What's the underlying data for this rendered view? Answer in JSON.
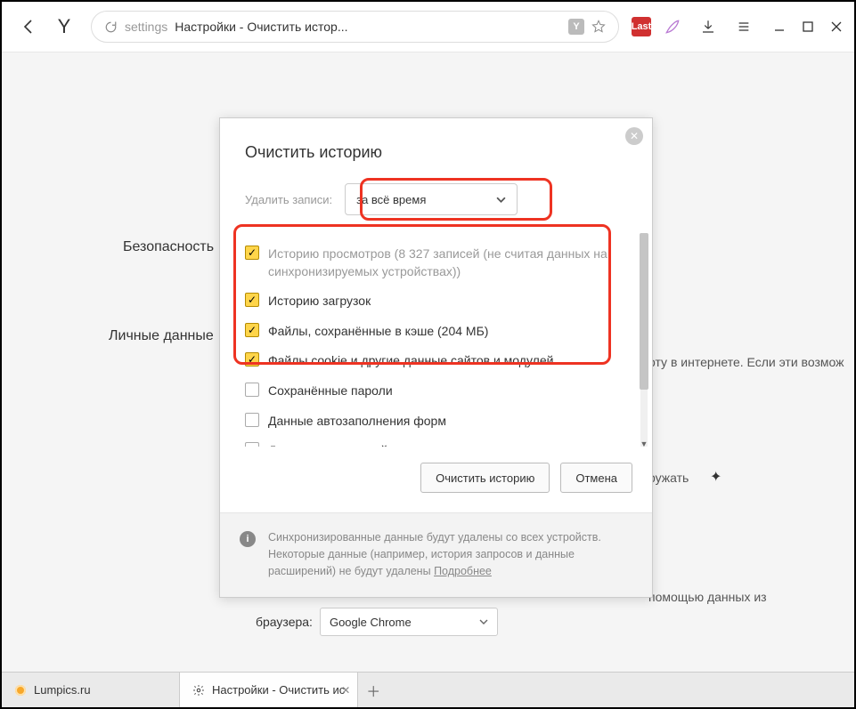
{
  "toolbar": {
    "address_label": "settings",
    "address_title": "Настройки - Очистить истор...",
    "ext_last": "Last",
    "y_badge": "Y"
  },
  "sidebar": {
    "security": "Безопасность",
    "personal": "Личные данные"
  },
  "bg": {
    "right1": "оту в интернете. Если эти возмож",
    "right2": "ружать",
    "right3": "помощью данных из",
    "browser_label": "браузера:",
    "browser_value": "Google Chrome"
  },
  "dialog": {
    "title": "Очистить историю",
    "delete_label": "Удалить записи:",
    "time_value": "за всё время",
    "items": [
      {
        "checked": true,
        "muted": true,
        "label": "Историю просмотров (8 327 записей (не считая данных на синхронизируемых устройствах))"
      },
      {
        "checked": true,
        "muted": false,
        "label": "Историю загрузок"
      },
      {
        "checked": true,
        "muted": false,
        "label": "Файлы, сохранённые в кэше (204 МБ)"
      },
      {
        "checked": true,
        "muted": false,
        "label": "Файлы cookie и другие данные сайтов и модулей"
      },
      {
        "checked": false,
        "muted": false,
        "label": "Сохранённые пароли"
      },
      {
        "checked": false,
        "muted": false,
        "label": "Данные автозаполнения форм"
      },
      {
        "checked": false,
        "muted": false,
        "label": "Данные приложений"
      }
    ],
    "clear_btn": "Очистить историю",
    "cancel_btn": "Отмена",
    "sync_line1": "Синхронизированные данные будут удалены со всех устройств.",
    "sync_line2_a": "Некоторые данные (например, история запросов и данные расширений) не будут удалены ",
    "sync_more": "Подробнее"
  },
  "tabs": {
    "t1": "Lumpics.ru",
    "t2": "Настройки - Очистить ис"
  }
}
